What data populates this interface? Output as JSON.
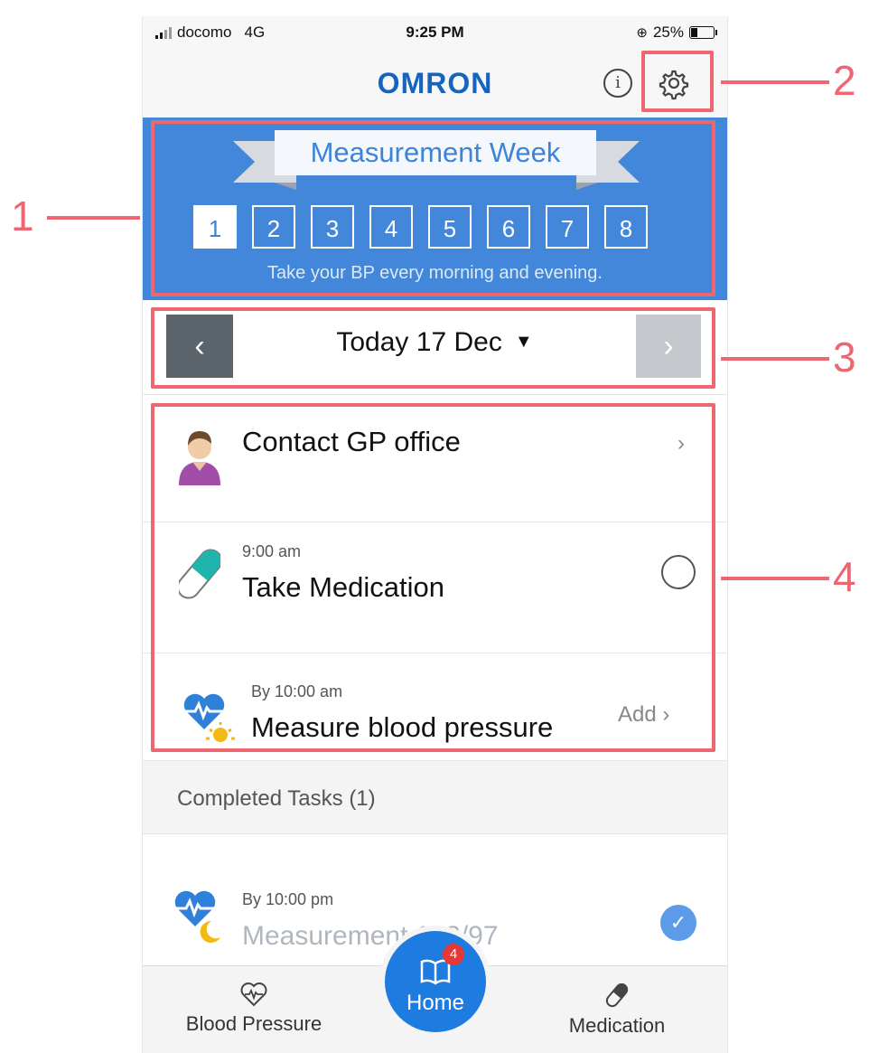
{
  "status_bar": {
    "carrier": "docomo",
    "network": "4G",
    "time": "9:25 PM",
    "battery": "25%"
  },
  "header": {
    "logo": "OMRON",
    "info_icon": "info-icon",
    "settings_icon": "gear-icon"
  },
  "banner": {
    "title": "Measurement Week",
    "weeks": [
      "1",
      "2",
      "3",
      "4",
      "5",
      "6",
      "7",
      "8"
    ],
    "active_week": "1",
    "caption": "Take your BP every morning and evening.",
    "color": "#4287d9"
  },
  "date_nav": {
    "label": "Today 17 Dec",
    "prev": "‹",
    "next": "›"
  },
  "tasks": [
    {
      "title": "Contact GP office",
      "icon": "doctor-avatar-icon",
      "action": "›"
    },
    {
      "time": "9:00 am",
      "title": "Take Medication",
      "icon": "pill-icon"
    },
    {
      "time": "By 10:00 am",
      "title": "Measure blood pressure",
      "icon": "heart-sun-icon",
      "action": "Add ›"
    }
  ],
  "completed": {
    "header": "Completed Tasks (1)",
    "items": [
      {
        "time": "By 10:00 pm",
        "title": "Measurement 143/97",
        "icon": "heart-moon-icon"
      }
    ]
  },
  "tab_bar": {
    "blood_pressure": "Blood Pressure",
    "home": "Home",
    "home_badge": "4",
    "medication": "Medication"
  },
  "annotations": [
    "1",
    "2",
    "3",
    "4"
  ]
}
